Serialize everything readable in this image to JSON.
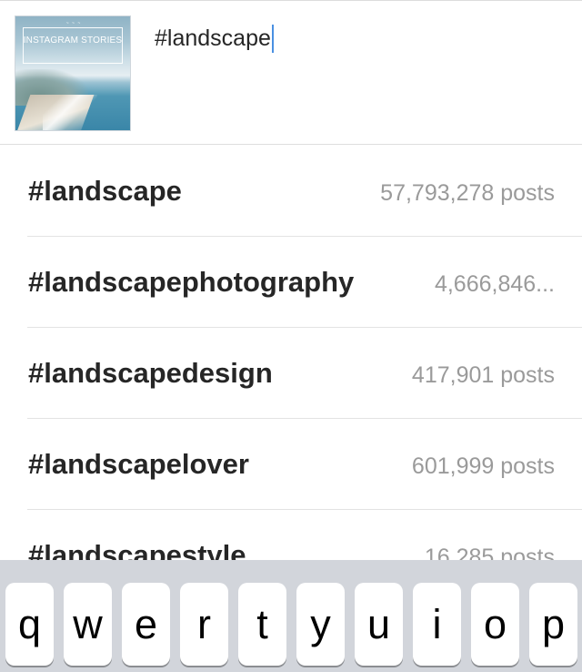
{
  "thumbnail": {
    "header_small": "~ ~ ~",
    "title": "INSTAGRAM STORIES"
  },
  "caption": {
    "text": "#landscape"
  },
  "suggestions": [
    {
      "tag": "#landscape",
      "count": "57,793,278 posts"
    },
    {
      "tag": "#landscapephotography",
      "count": "4,666,846..."
    },
    {
      "tag": "#landscapedesign",
      "count": "417,901 posts"
    },
    {
      "tag": "#landscapelover",
      "count": "601,999 posts"
    },
    {
      "tag": "#landscapestyle",
      "count": "16,285 posts"
    }
  ],
  "keyboard": {
    "keys": [
      "q",
      "w",
      "e",
      "r",
      "t",
      "y",
      "u",
      "i",
      "o",
      "p"
    ]
  },
  "colors": {
    "caret": "#4a90e2",
    "keyboard_bg": "#d2d5db"
  }
}
